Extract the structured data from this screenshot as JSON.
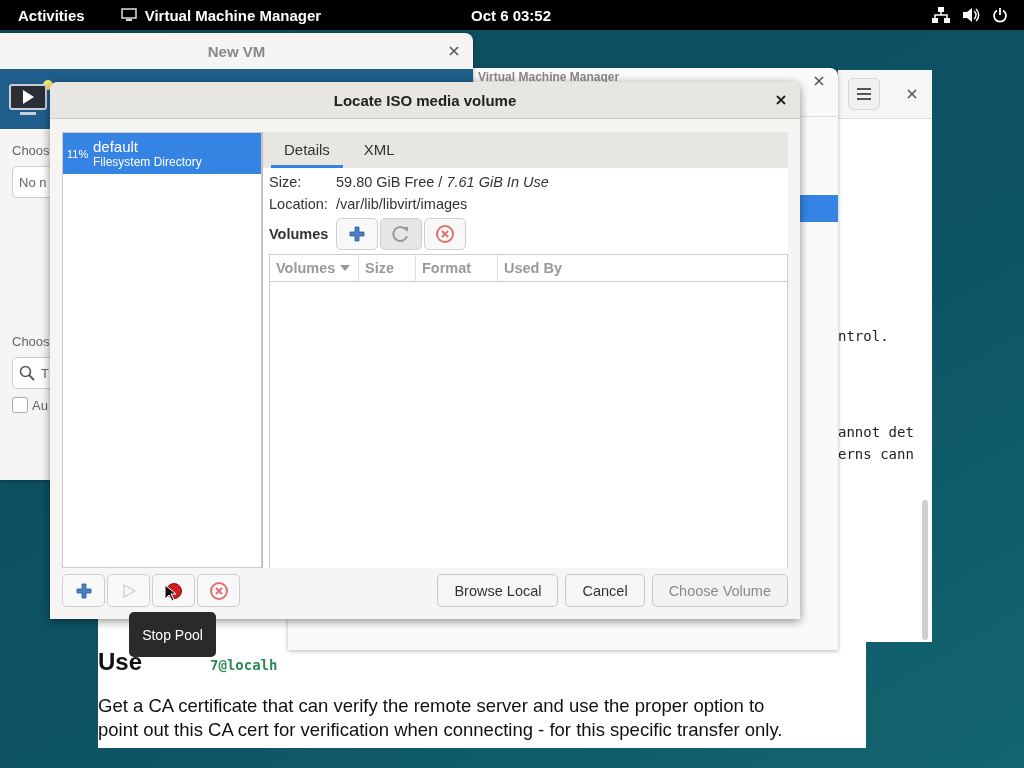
{
  "top_bar": {
    "activities": "Activities",
    "app_name": "Virtual Machine Manager",
    "clock": "Oct 6  03:52"
  },
  "browser_page": {
    "heading": "Use",
    "code": "7@localh",
    "paragraph_lines": [
      "Get a CA certificate that can verify the remote server and use the proper option to",
      "point out this CA cert for verification when connecting - for this specific transfer only."
    ]
  },
  "browser_window": {
    "text_lines": [
      "ntrol.",
      "annot det",
      "erns cann"
    ]
  },
  "manager_window": {
    "title": "Virtual Machine Manager"
  },
  "new_vm_window": {
    "title": "New VM",
    "label_1": "Choos",
    "field_value": "No n",
    "label_2": "Choos",
    "search_value": "T",
    "checkbox": {
      "label": "Au",
      "checked": false
    }
  },
  "dialog": {
    "title": "Locate ISO media volume",
    "pools": [
      {
        "usage": "11%",
        "name": "default",
        "type": "Filesystem Directory",
        "selected": true
      }
    ],
    "tabs": [
      {
        "label": "Details",
        "selected": true
      },
      {
        "label": "XML",
        "selected": false
      }
    ],
    "size_label": "Size:",
    "size_value": "59.80 GiB Free / *7.61 GiB In Use*",
    "location_label": "Location:",
    "location": "/var/lib/libvirt/images",
    "volumes_label": "Volumes",
    "volume_buttons": [
      {
        "kind": "add",
        "disabled": false
      },
      {
        "kind": "refresh",
        "disabled": false
      },
      {
        "kind": "delete",
        "disabled": false
      }
    ],
    "columns": [
      {
        "label": "Volumes",
        "sorted": true
      },
      {
        "label": "Size",
        "sorted": false
      },
      {
        "label": "Format",
        "sorted": false
      },
      {
        "label": "Used By",
        "sorted": false
      }
    ],
    "pool_buttons": [
      {
        "kind": "add",
        "disabled": false
      },
      {
        "kind": "start",
        "disabled": true
      },
      {
        "kind": "stop",
        "disabled": false
      },
      {
        "kind": "delete",
        "disabled": false
      }
    ],
    "buttons": [
      {
        "label": "Browse Local",
        "disabled": false
      },
      {
        "label": "Cancel",
        "disabled": false
      },
      {
        "label": "Choose Volume",
        "disabled": true
      }
    ]
  },
  "tooltip": "Stop Pool"
}
